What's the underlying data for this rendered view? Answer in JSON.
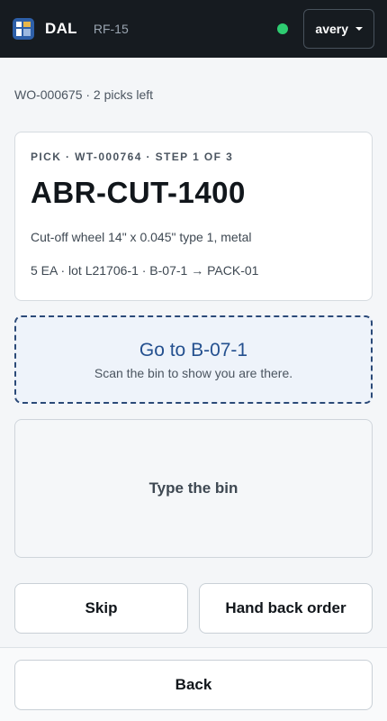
{
  "header": {
    "brand": "DAL",
    "device": "RF-15",
    "user": "avery",
    "colors": {
      "bar": "#161b20",
      "status": "#2ecc71",
      "accent": "#24508f"
    }
  },
  "order": {
    "crumb": "WO-000675 · 2 picks left"
  },
  "pick": {
    "step_label": "PICK · WT-000764 · STEP 1 OF 3",
    "sku": "ABR-CUT-1400",
    "description": "Cut-off wheel 14\" x 0.045\" type 1, metal",
    "meta": "5 EA · lot L21706-1 · B-07-1 → PACK-01"
  },
  "goto": {
    "title": "Go to B-07-1",
    "subtitle": "Scan the bin to show you are there."
  },
  "entry": {
    "prompt": "Type the bin"
  },
  "actions": {
    "skip": "Skip",
    "hand_back": "Hand back order",
    "back": "Back"
  }
}
